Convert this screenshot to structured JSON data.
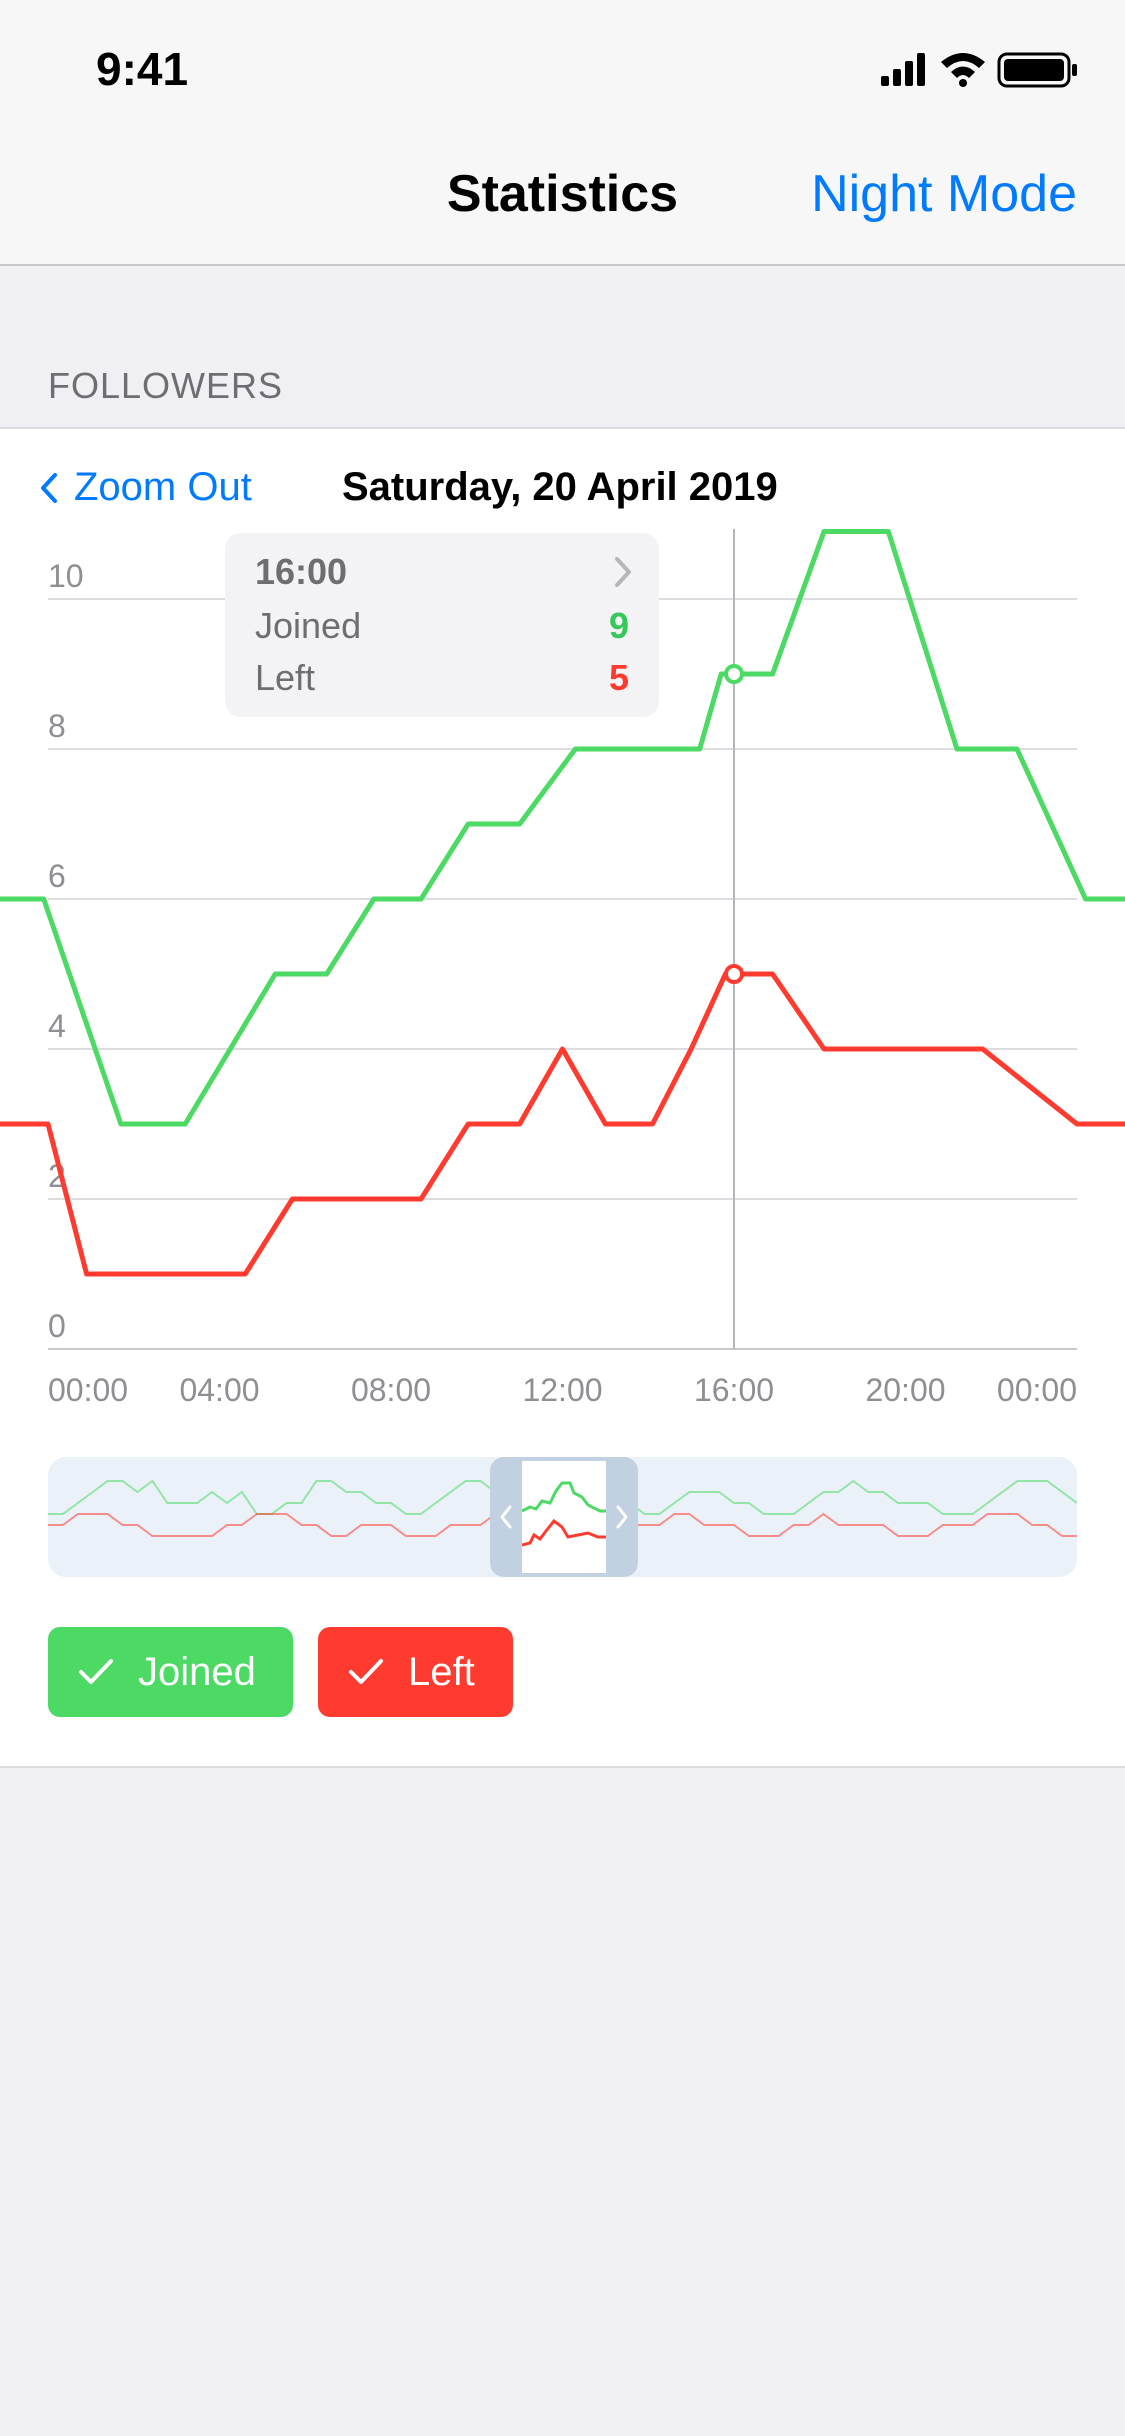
{
  "status_bar": {
    "time": "9:41"
  },
  "nav": {
    "title": "Statistics",
    "right_button": "Night Mode"
  },
  "section": {
    "header": "FOLLOWERS"
  },
  "chart_header": {
    "zoom_out": "Zoom Out",
    "date": "Saturday, 20 April 2019"
  },
  "tooltip": {
    "time": "16:00",
    "rows": [
      {
        "label": "Joined",
        "value": "9",
        "color": "#34c759"
      },
      {
        "label": "Left",
        "value": "5",
        "color": "#ff3b30"
      }
    ]
  },
  "legend": [
    {
      "label": "Joined",
      "color": "#4cd964",
      "checked": true
    },
    {
      "label": "Left",
      "color": "#ff3b30",
      "checked": true
    }
  ],
  "colors": {
    "accent": "#007aff",
    "joined": "#4cd964",
    "left": "#ff3b30",
    "grid": "#dcdce0"
  },
  "chart_data": {
    "type": "line",
    "title": "",
    "xlabel": "",
    "ylabel": "",
    "x_tick_labels": [
      "00:00",
      "04:00",
      "08:00",
      "12:00",
      "16:00",
      "20:00",
      "00:00"
    ],
    "y_tick_labels": [
      "0",
      "2",
      "4",
      "6",
      "8",
      "10"
    ],
    "xlim": [
      0,
      24
    ],
    "ylim": [
      0,
      10
    ],
    "grid": true,
    "selected_x": 16,
    "series": [
      {
        "name": "Joined",
        "color": "#4cd964",
        "points": [
          [
            -1.2,
            6
          ],
          [
            -0.1,
            6
          ],
          [
            1.7,
            3
          ],
          [
            3.2,
            3
          ],
          [
            5.3,
            5
          ],
          [
            6.5,
            5
          ],
          [
            7.6,
            6
          ],
          [
            8.7,
            6
          ],
          [
            9.8,
            7
          ],
          [
            11.0,
            7
          ],
          [
            12.3,
            8
          ],
          [
            15.2,
            8
          ],
          [
            15.7,
            9
          ],
          [
            16.9,
            9
          ],
          [
            18.1,
            10.9
          ],
          [
            19.6,
            10.9
          ],
          [
            21.2,
            8
          ],
          [
            22.6,
            8
          ],
          [
            24.2,
            6
          ],
          [
            26.6,
            6
          ]
        ]
      },
      {
        "name": "Left",
        "color": "#ff3b30",
        "points": [
          [
            -1.2,
            3
          ],
          [
            0.0,
            3
          ],
          [
            0.9,
            1
          ],
          [
            4.6,
            1
          ],
          [
            5.7,
            2
          ],
          [
            8.7,
            2
          ],
          [
            9.8,
            3
          ],
          [
            11.0,
            3
          ],
          [
            12.0,
            4
          ],
          [
            13.0,
            3
          ],
          [
            14.1,
            3
          ],
          [
            15.0,
            4
          ],
          [
            15.8,
            5
          ],
          [
            16.9,
            5
          ],
          [
            18.1,
            4
          ],
          [
            21.8,
            4
          ],
          [
            24.0,
            3
          ],
          [
            26.6,
            3
          ]
        ]
      }
    ]
  },
  "navigator_data": {
    "joined": [
      5,
      5,
      6,
      7,
      8,
      8,
      7,
      8,
      6,
      6,
      6,
      7,
      6,
      7,
      5,
      5,
      6,
      6,
      8,
      8,
      7,
      7,
      6,
      6,
      5,
      5,
      6,
      7,
      8,
      8,
      7,
      7,
      6,
      6,
      7,
      8,
      8,
      8,
      7,
      6,
      5,
      5,
      6,
      7,
      7,
      7,
      6,
      6,
      5,
      5,
      5,
      6,
      7,
      7,
      8,
      7,
      7,
      6,
      6,
      6,
      5,
      5,
      5,
      6,
      7,
      8,
      8,
      8,
      7,
      6
    ],
    "left": [
      4,
      4,
      5,
      5,
      5,
      4,
      4,
      3,
      3,
      3,
      3,
      3,
      4,
      4,
      5,
      5,
      5,
      4,
      4,
      3,
      3,
      4,
      4,
      4,
      3,
      3,
      3,
      4,
      4,
      4,
      5,
      4,
      4,
      4,
      3,
      3,
      3,
      3,
      3,
      4,
      4,
      4,
      5,
      5,
      4,
      4,
      4,
      3,
      3,
      3,
      4,
      4,
      5,
      4,
      4,
      4,
      4,
      3,
      3,
      3,
      4,
      4,
      4,
      5,
      5,
      5,
      4,
      4,
      3,
      3
    ]
  }
}
